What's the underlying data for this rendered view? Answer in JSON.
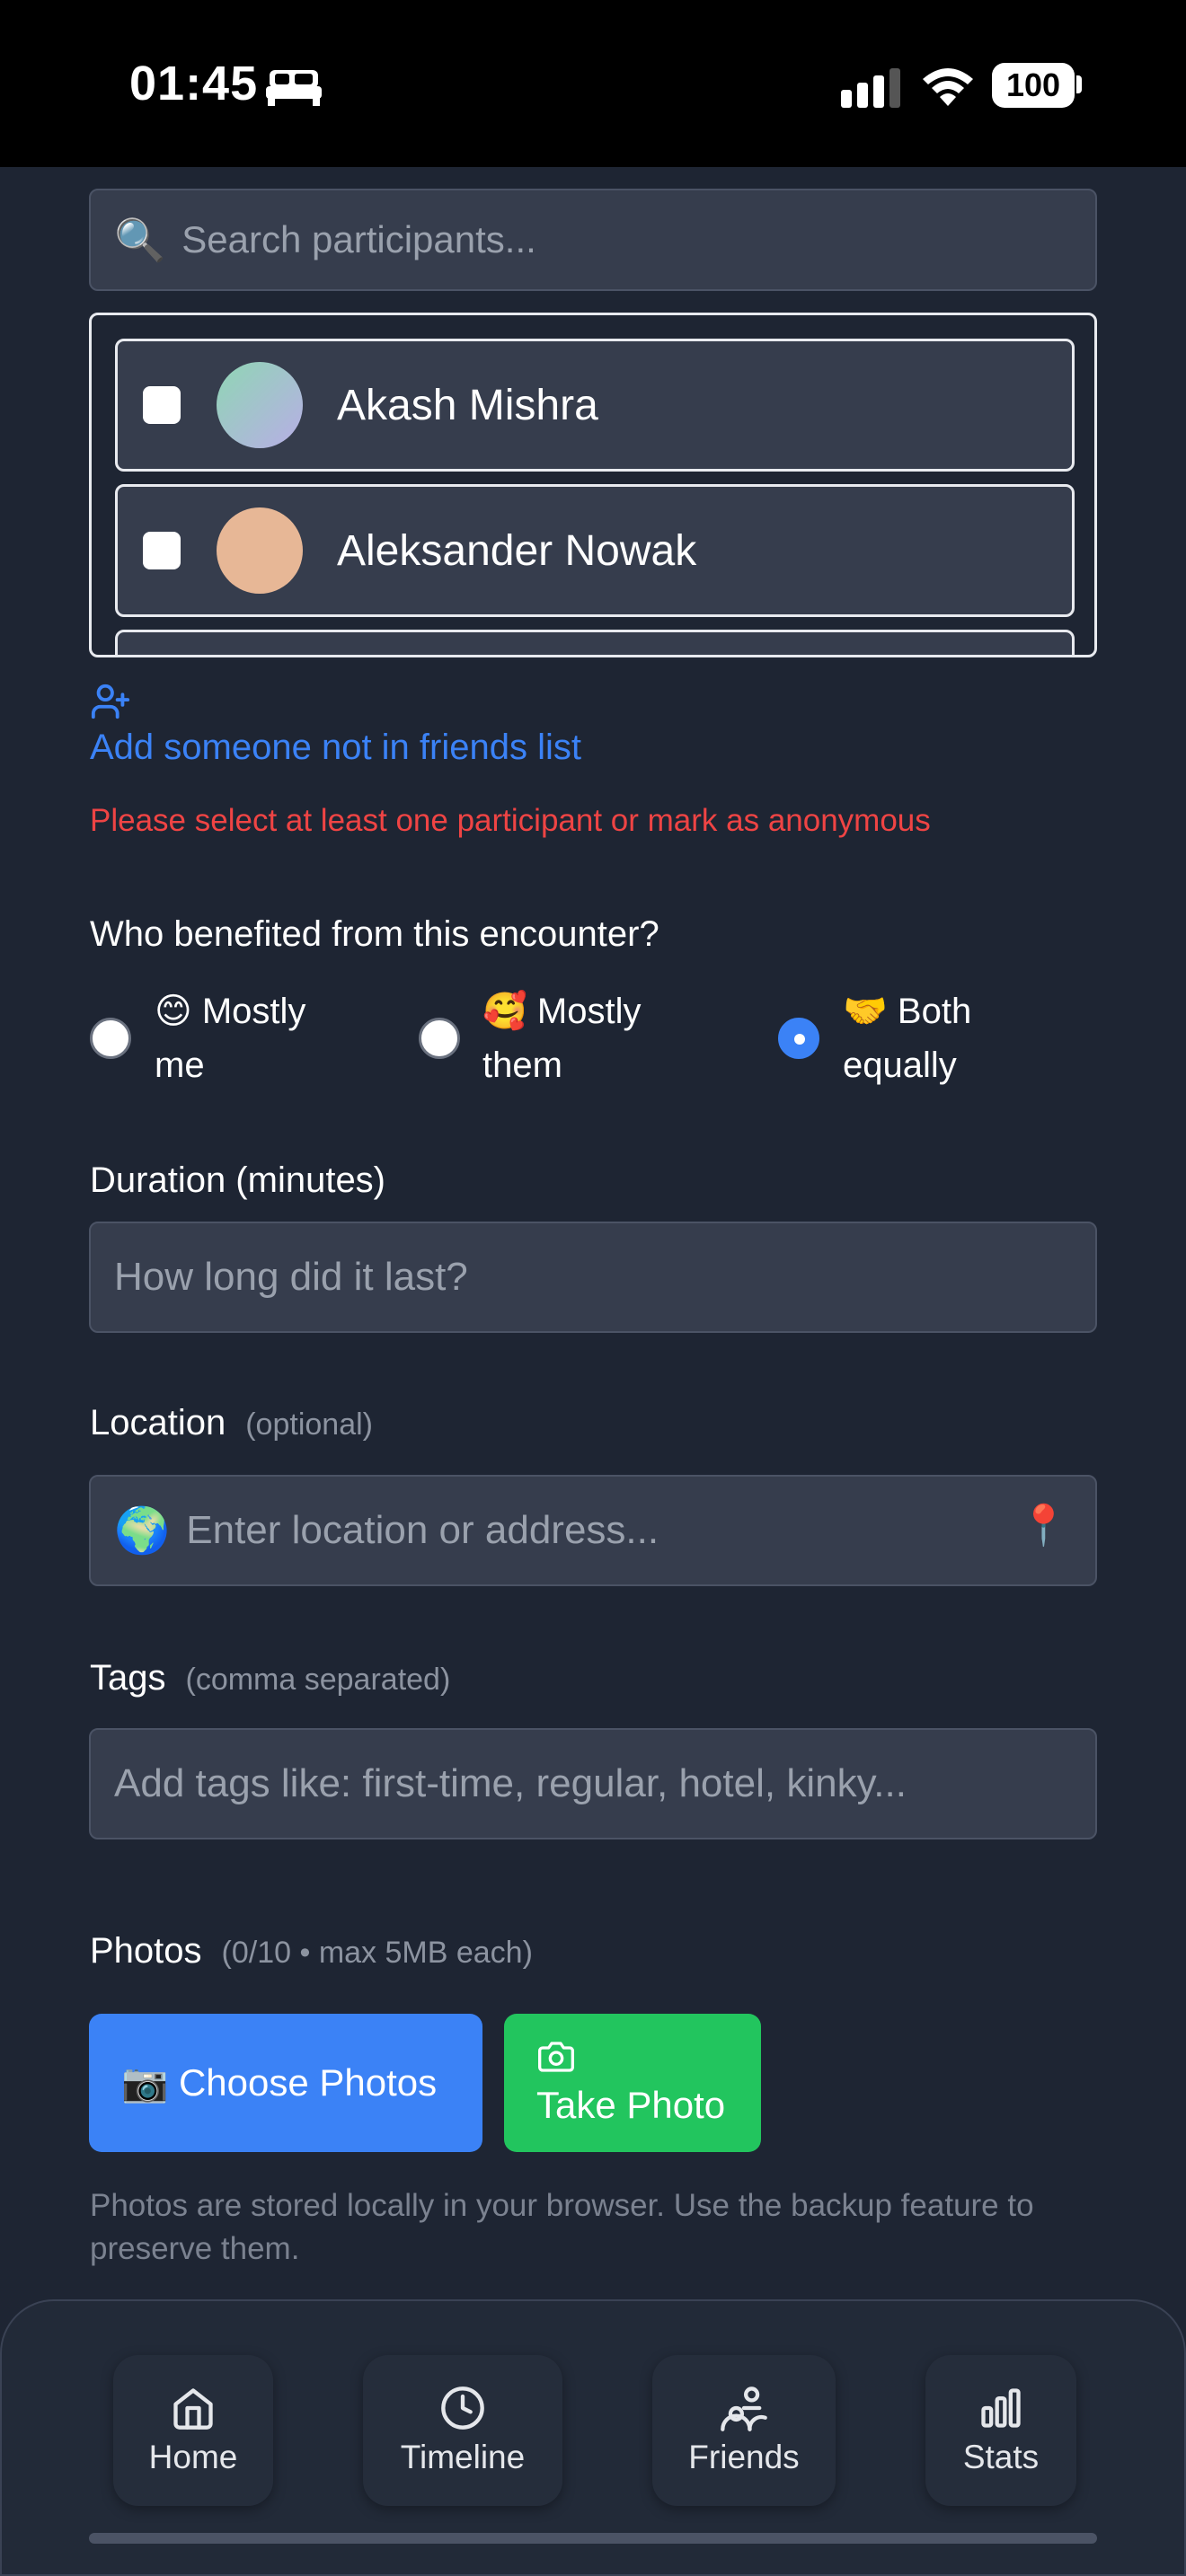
{
  "status_bar": {
    "time": "01:45",
    "battery": "100"
  },
  "search": {
    "emoji": "🔍",
    "placeholder": "Search participants..."
  },
  "participants": [
    {
      "name": "Akash Mishra",
      "avatar_colors": [
        "#8fd6b4",
        "#b8aee6"
      ]
    },
    {
      "name": "Aleksander Nowak",
      "avatar_colors": [
        "#e7b796",
        "#e7b796"
      ]
    }
  ],
  "add_someone": {
    "label": "Add someone not in friends list",
    "icon": "user-plus-icon"
  },
  "error": "Please select at least one participant or mark as anonymous",
  "benefit": {
    "question": "Who benefited from this encounter?",
    "options": [
      {
        "label": "😊 Mostly me",
        "selected": false
      },
      {
        "label": "🥰 Mostly them",
        "selected": false
      },
      {
        "label": "🤝 Both equally",
        "selected": true
      }
    ]
  },
  "duration": {
    "label": "Duration (minutes)",
    "placeholder": "How long did it last?"
  },
  "location": {
    "label": "Location",
    "hint": "(optional)",
    "emoji": "🌍",
    "placeholder": "Enter location or address...",
    "pin_emoji": "📍"
  },
  "tags": {
    "label": "Tags",
    "hint": "(comma separated)",
    "placeholder": "Add tags like: first-time, regular, hotel, kinky..."
  },
  "photos": {
    "label": "Photos",
    "hint": "(0/10 • max 5MB each)",
    "choose_label": "📷 Choose Photos",
    "take_label": "Take Photo",
    "note": "Photos are stored locally in your browser. Use the backup feature to preserve them."
  },
  "nav": [
    {
      "label": "Home",
      "icon": "home-icon"
    },
    {
      "label": "Timeline",
      "icon": "clock-icon"
    },
    {
      "label": "Friends",
      "icon": "friends-icon"
    },
    {
      "label": "Stats",
      "icon": "bar-chart-icon"
    }
  ],
  "colors": {
    "accent": "#3b82f6",
    "success": "#22c55e",
    "error": "#ef4444",
    "background": "#1e2533"
  }
}
